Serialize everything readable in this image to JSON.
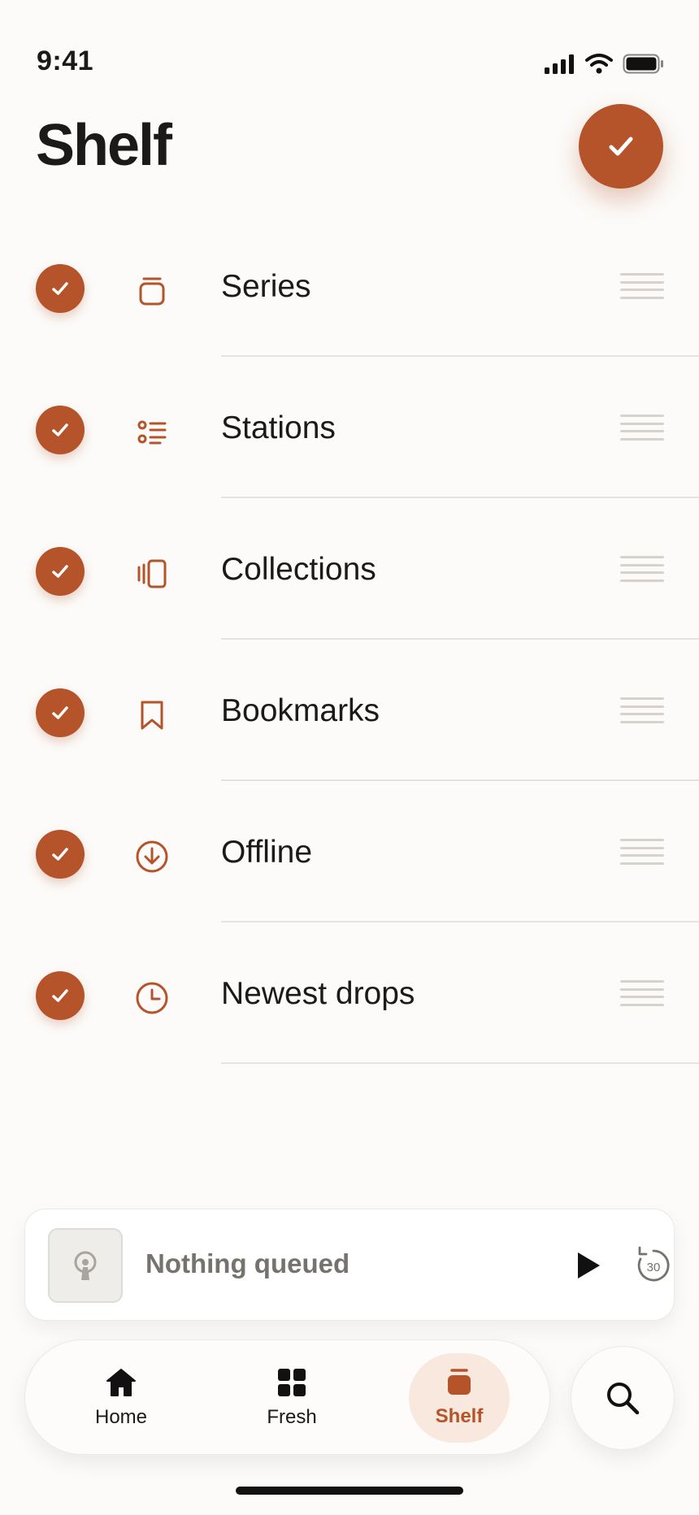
{
  "status_bar": {
    "time": "9:41"
  },
  "header": {
    "title": "Shelf"
  },
  "items": [
    {
      "label": "Series",
      "icon": "stack-icon"
    },
    {
      "label": "Stations",
      "icon": "list-icon"
    },
    {
      "label": "Collections",
      "icon": "cards-icon"
    },
    {
      "label": "Bookmarks",
      "icon": "bookmark-icon"
    },
    {
      "label": "Offline",
      "icon": "download-icon"
    },
    {
      "label": "Newest drops",
      "icon": "clock-icon"
    }
  ],
  "player": {
    "status": "Nothing queued",
    "skip_seconds": "30"
  },
  "tabs": {
    "home": "Home",
    "fresh": "Fresh",
    "shelf": "Shelf"
  },
  "colors": {
    "accent": "#b5532b",
    "background": "#fcfbf9"
  }
}
